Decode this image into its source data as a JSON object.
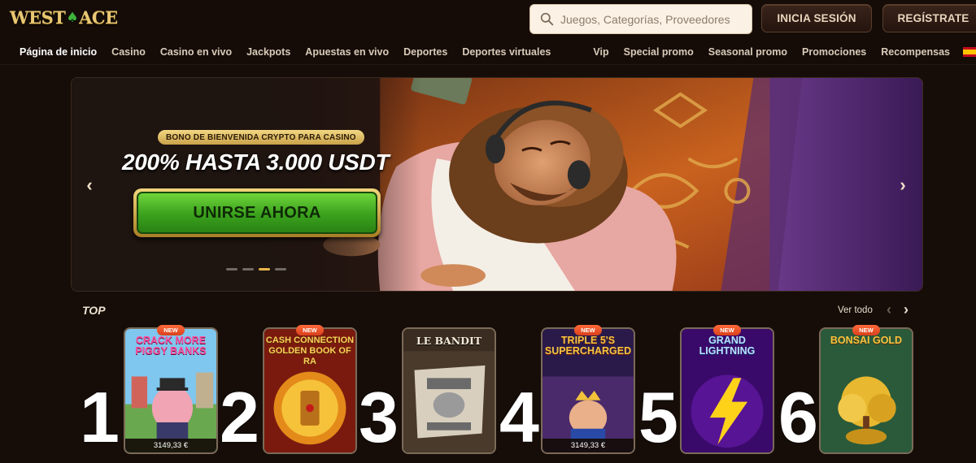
{
  "header": {
    "logo_text_left": "WEST",
    "logo_text_right": "ACE",
    "search_placeholder": "Juegos, Categorías, Proveedores",
    "login_label": "INICIA SESIÓN",
    "register_label": "REGÍSTRATE"
  },
  "nav": {
    "left": [
      "Página de inicio",
      "Casino",
      "Casino en vivo",
      "Jackpots",
      "Apuestas en vivo",
      "Deportes",
      "Deportes virtuales"
    ],
    "right": [
      "Vip",
      "Special promo",
      "Seasonal promo",
      "Promociones",
      "Recompensas"
    ],
    "active_index": 0
  },
  "hero": {
    "badge": "BONO DE BIENVENIDA CRYPTO PARA CASINO",
    "title": "200% HASTA 3.000 USDT",
    "cta": "UNIRSE AHORA",
    "slides": 4,
    "active_slide": 2
  },
  "top_section": {
    "title": "TOP",
    "see_all": "Ver todo"
  },
  "games": [
    {
      "rank": "1",
      "title": "CRACK MORE PIGGY BANKS",
      "badge": "NEW",
      "price": "3149,33 €"
    },
    {
      "rank": "2",
      "title": "CASH CONNECTION GOLDEN BOOK OF RA",
      "badge": "NEW",
      "price": ""
    },
    {
      "rank": "3",
      "title": "LE BANDIT",
      "badge": "",
      "price": ""
    },
    {
      "rank": "4",
      "title": "TRIPLE 5'S SUPERCHARGED",
      "badge": "NEW",
      "price": "3149,33 €"
    },
    {
      "rank": "5",
      "title": "GRAND LIGHTNING",
      "badge": "NEW",
      "price": ""
    },
    {
      "rank": "6",
      "title": "BONSAI GOLD",
      "badge": "NEW",
      "price": ""
    }
  ],
  "colors": {
    "background": "#160d08",
    "accent_gold": "#e8b54a",
    "cta_green": "#3aa11d",
    "badge_orange": "#e04a20"
  }
}
